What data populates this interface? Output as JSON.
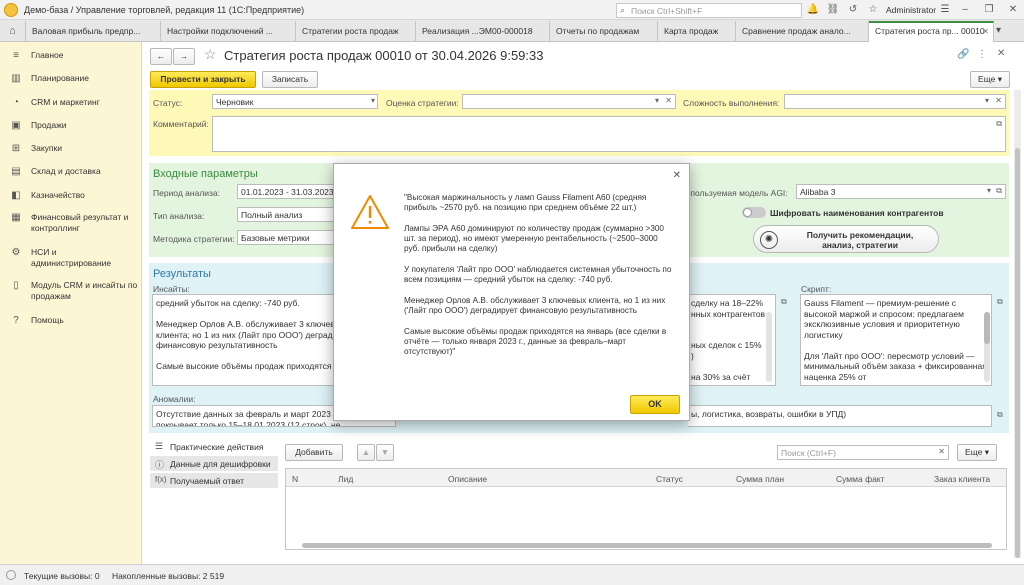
{
  "window": {
    "title": "Демо-база / Управление торговлей, редакция 11  (1С:Предприятие)",
    "search_placeholder": "Поиск Ctrl+Shift+F",
    "user": "Administrator"
  },
  "tabs": [
    {
      "label": "Валовая прибыль предпр..."
    },
    {
      "label": "Настройки подключений ..."
    },
    {
      "label": "Стратегии роста продаж"
    },
    {
      "label": "Реализация ...ЭМ00-000018"
    },
    {
      "label": "Отчеты по продажам"
    },
    {
      "label": "Карта продаж"
    },
    {
      "label": "Сравнение продаж анало..."
    },
    {
      "label": "Стратегия роста пр... 00010"
    }
  ],
  "sidebar": {
    "items": [
      {
        "label": "Главное",
        "icon": "menu-icon"
      },
      {
        "label": "Планирование",
        "icon": "chart-icon"
      },
      {
        "label": "CRM и маркетинг",
        "icon": "pie-icon"
      },
      {
        "label": "Продажи",
        "icon": "bag-icon"
      },
      {
        "label": "Закупки",
        "icon": "cart-icon"
      },
      {
        "label": "Склад и доставка",
        "icon": "truck-icon"
      },
      {
        "label": "Казначейство",
        "icon": "wallet-icon"
      },
      {
        "label": "Финансовый результат и контроллинг",
        "icon": "finance-icon"
      },
      {
        "label": "НСИ и администрирование",
        "icon": "gear-icon"
      },
      {
        "label": "Модуль CRM и инсайты по продажам",
        "icon": "document-icon"
      },
      {
        "label": "Помощь",
        "icon": "help-icon"
      }
    ]
  },
  "form": {
    "title": "Стратегия роста продаж 00010 от 30.04.2026 9:59:33",
    "btn_post_close": "Провести и закрыть",
    "btn_save": "Записать",
    "btn_more": "Еще",
    "status_label": "Статус:",
    "status_value": "Черновик",
    "rating_label": "Оценка стратегии:",
    "complexity_label": "Сложность выполнения:",
    "comment_label": "Комментарий:",
    "input_header": "Входные параметры",
    "period_label": "Период анализа:",
    "period_value": "01.01.2023 - 31.03.2023",
    "type_label": "Тип анализа:",
    "type_value": "Полный анализ",
    "method_label": "Методика стратегии:",
    "method_value": "Базовые метрики",
    "model_label": "Используемая модель AGI:",
    "model_value": "Alibaba 3",
    "encrypt_label": "Шифровать наименования контрагентов",
    "recommend_btn": "Получить рекомендации,\nанализ, стратегии",
    "results_header": "Результаты",
    "insights_label": "Инсайты:",
    "insights_text": "средний убыток на сделку: -740 руб.\n\nМенеджер Орлов А.В. обслуживает 3 ключевых клиента; но 1 из них (Лайт про ООО') деградирует финансовую результативность\n\nСамые высокие объёмы продаж приходятся",
    "mid_text": "сделку на 18–22%\nнных контрагентов\n\n\nных сделок с 15%\n)\n\nна 30% за счёт",
    "script_label": "Скрипт:",
    "script_text": "Gauss Filament — премиум-решение с высокой маржой и спросом: предлагаем эксклюзивные условия и приоритетную логистику\n\nДля 'Лайт про ООО': пересмотр условий — минимальный объём заказа + фиксированная наценка 25% от",
    "anomalies_label": "Аномалии:",
    "anomalies_text": "Отсутствие данных за февраль и март 2023\nпокрывает только 15–18.01.2023 (12 строк), не соответствует",
    "anomalies_right_text": "ы, логистика, возвраты, ошибки в УПД)"
  },
  "bottom": {
    "panel_items": [
      {
        "label": "Практические действия",
        "icon": "list-icon"
      },
      {
        "label": "Данные для дешифровки",
        "icon": "info-icon"
      },
      {
        "label": "Получаемый ответ",
        "icon": "function-icon"
      }
    ],
    "add_btn": "Добавить",
    "search_placeholder": "Поиск (Ctrl+F)",
    "more_btn": "Еще",
    "columns": [
      "N",
      "Лид",
      "Описание",
      "Статус",
      "Сумма план",
      "Сумма факт",
      "Заказ клиента"
    ]
  },
  "dialog": {
    "message": "\"Высокая маржинальность у ламп Gauss Filament A60 (средняя прибыль ~2570 руб. на позицию при среднем объёме 22 шт.)\n\nЛампы ЭРА A60 доминируют по количеству продаж (суммарно >300 шт. за период), но имеют умеренную рентабельность (~2500–3000 руб. прибыли на сделку)\n\nУ покупателя 'Лайт про ООО' наблюдается системная убыточность по всем позициям — средний убыток на сделку: -740 руб.\n\nМенеджер Орлов А.В. обслуживает 3 ключевых клиента, но 1 из них ('Лайт про ООО') деградирует финансовую результативность\n\nСамые высокие объёмы продаж приходятся на январь (все сделки в отчёте — только января 2023 г., данные за февраль–март отсутствуют)\"",
    "ok_label": "OK",
    "icon": "warning-icon"
  },
  "statusbar": {
    "current_calls": "Текущие вызовы: 0",
    "accumulated_calls": "Накопленные вызовы: 2 519"
  },
  "colors": {
    "sidebar_bg": "#fdf6d5",
    "header_yellow": "#fff9b8",
    "input_green": "#e4f5df",
    "results_cyan": "#dff3f7",
    "accent_yellow": "#f0c800",
    "header_green": "#3a8a3e"
  }
}
